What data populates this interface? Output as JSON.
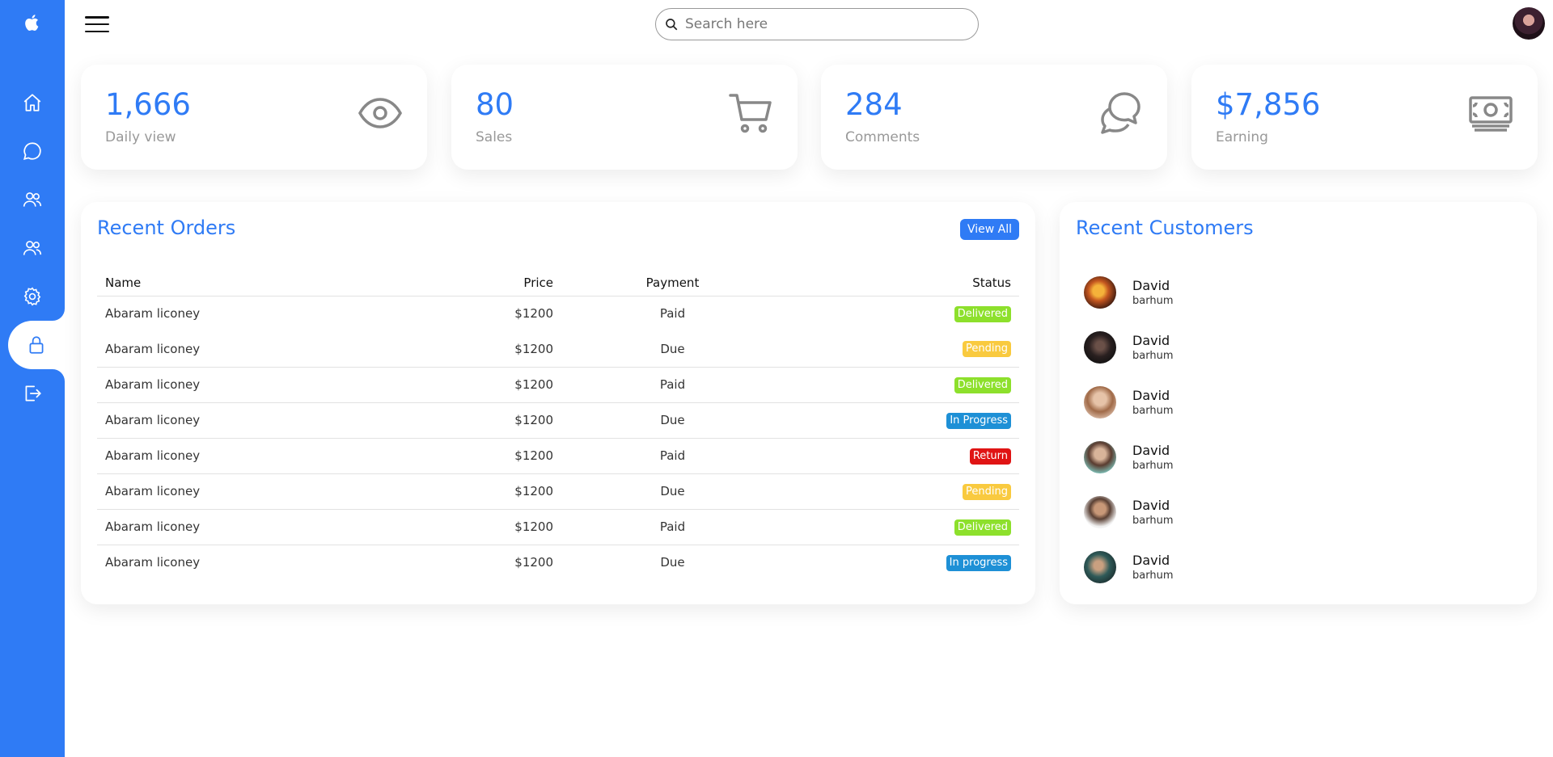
{
  "sidebar": {
    "items": [
      {
        "name": "home",
        "icon": "home-icon"
      },
      {
        "name": "messages",
        "icon": "chat-bubble-icon"
      },
      {
        "name": "customers",
        "icon": "people-icon"
      },
      {
        "name": "users",
        "icon": "people-icon"
      },
      {
        "name": "settings",
        "icon": "gear-icon"
      },
      {
        "name": "password",
        "icon": "lock-icon",
        "active": true
      },
      {
        "name": "sign-out",
        "icon": "log-out-icon"
      }
    ],
    "accent": "#2f7bf5"
  },
  "search": {
    "placeholder": "Search here"
  },
  "cards": [
    {
      "number": "1,666",
      "label": "Daily view",
      "icon": "eye-icon"
    },
    {
      "number": "80",
      "label": "Sales",
      "icon": "cart-icon"
    },
    {
      "number": "284",
      "label": "Comments",
      "icon": "chat-bubbles-icon"
    },
    {
      "number": "$7,856",
      "label": "Earning",
      "icon": "cash-icon"
    }
  ],
  "orders": {
    "title": "Recent Orders",
    "view_all": "View All",
    "headers": {
      "name": "Name",
      "price": "Price",
      "payment": "Payment",
      "status": "Status"
    },
    "rows": [
      {
        "name": "Abaram liconey",
        "price": "$1200",
        "payment": "Paid",
        "status": "Delivered",
        "color": "#8de02c"
      },
      {
        "name": "Abaram liconey",
        "price": "$1200",
        "payment": "Due",
        "status": "Pending",
        "color": "#f9ca3f"
      },
      {
        "name": "Abaram liconey",
        "price": "$1200",
        "payment": "Paid",
        "status": "Delivered",
        "color": "#8de02c"
      },
      {
        "name": "Abaram liconey",
        "price": "$1200",
        "payment": "Due",
        "status": "In Progress",
        "color": "#1e90d6"
      },
      {
        "name": "Abaram liconey",
        "price": "$1200",
        "payment": "Paid",
        "status": "Return",
        "color": "#e01414"
      },
      {
        "name": "Abaram liconey",
        "price": "$1200",
        "payment": "Due",
        "status": "Pending",
        "color": "#f9ca3f"
      },
      {
        "name": "Abaram liconey",
        "price": "$1200",
        "payment": "Paid",
        "status": "Delivered",
        "color": "#8de02c"
      },
      {
        "name": "Abaram liconey",
        "price": "$1200",
        "payment": "Due",
        "status": "In progress",
        "color": "#1e90d6"
      }
    ]
  },
  "customers": {
    "title": "Recent Customers",
    "items": [
      {
        "name": "David",
        "sub": "barhum"
      },
      {
        "name": "David",
        "sub": "barhum"
      },
      {
        "name": "David",
        "sub": "barhum"
      },
      {
        "name": "David",
        "sub": "barhum"
      },
      {
        "name": "David",
        "sub": "barhum"
      },
      {
        "name": "David",
        "sub": "barhum"
      }
    ]
  }
}
